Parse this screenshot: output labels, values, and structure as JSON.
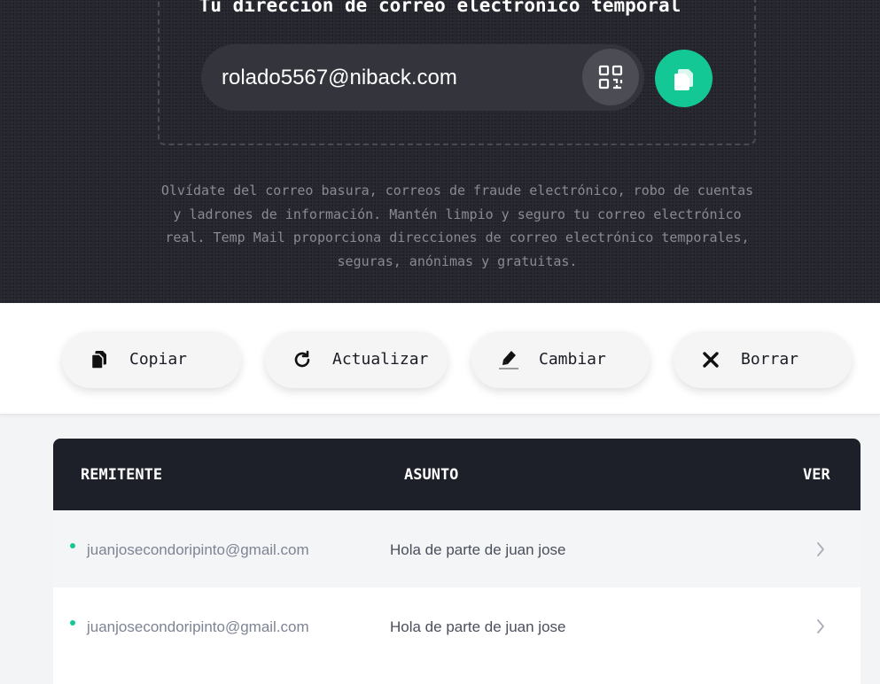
{
  "hero": {
    "title": "Tu dirección de correo electrónico temporal",
    "email": "rolado5567@niback.com",
    "description": "Olvídate del correo basura, correos de fraude electrónico, robo de cuentas y ladrones de información. Mantén limpio y seguro tu correo electrónico real. Temp Mail proporciona direcciones de correo electrónico temporales, seguras, anónimas y gratuitas."
  },
  "actions": [
    {
      "label": "Copiar",
      "icon": "copy-icon"
    },
    {
      "label": "Actualizar",
      "icon": "refresh-icon"
    },
    {
      "label": "Cambiar",
      "icon": "edit-icon"
    },
    {
      "label": "Borrar",
      "icon": "delete-icon"
    }
  ],
  "inbox": {
    "columns": {
      "sender": "REMITENTE",
      "subject": "ASUNTO",
      "view": "VER"
    },
    "rows": [
      {
        "sender": "juanjosecondoripinto@gmail.com",
        "subject": "Hola de parte de juan jose"
      },
      {
        "sender": "juanjosecondoripinto@gmail.com",
        "subject": "Hola de parte de juan jose"
      }
    ]
  },
  "colors": {
    "accent": "#14c896",
    "hero_bg": "#26262e",
    "table_header_bg": "#1e2029"
  }
}
